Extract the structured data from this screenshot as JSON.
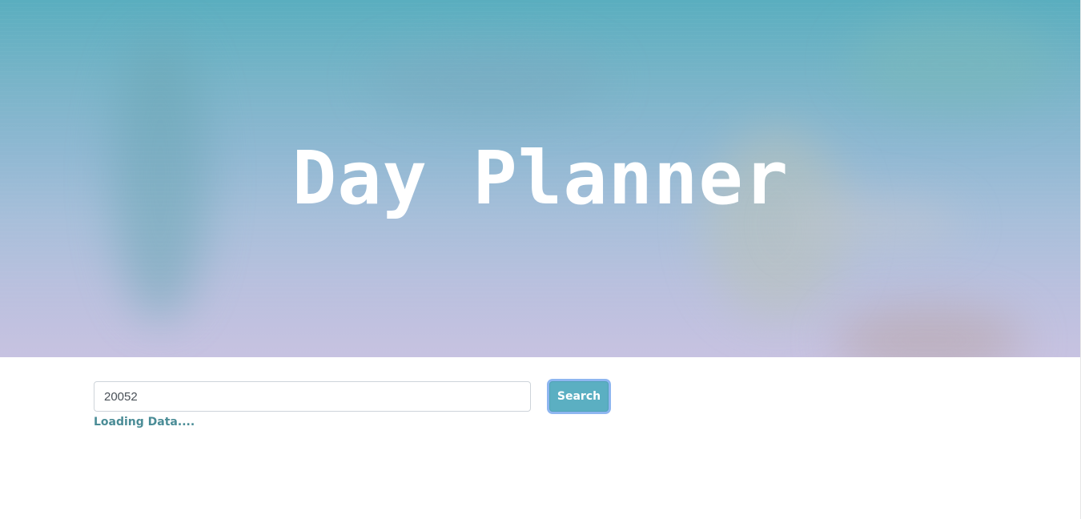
{
  "header": {
    "title": "Day Planner"
  },
  "search": {
    "input_value": "20052",
    "button_label": "Search"
  },
  "status": {
    "message": "Loading Data...."
  },
  "colors": {
    "button": "#5bafc2",
    "status_text": "#4a8c96",
    "hero_top": "#5aaebf",
    "hero_bottom": "#c7c2e1"
  }
}
